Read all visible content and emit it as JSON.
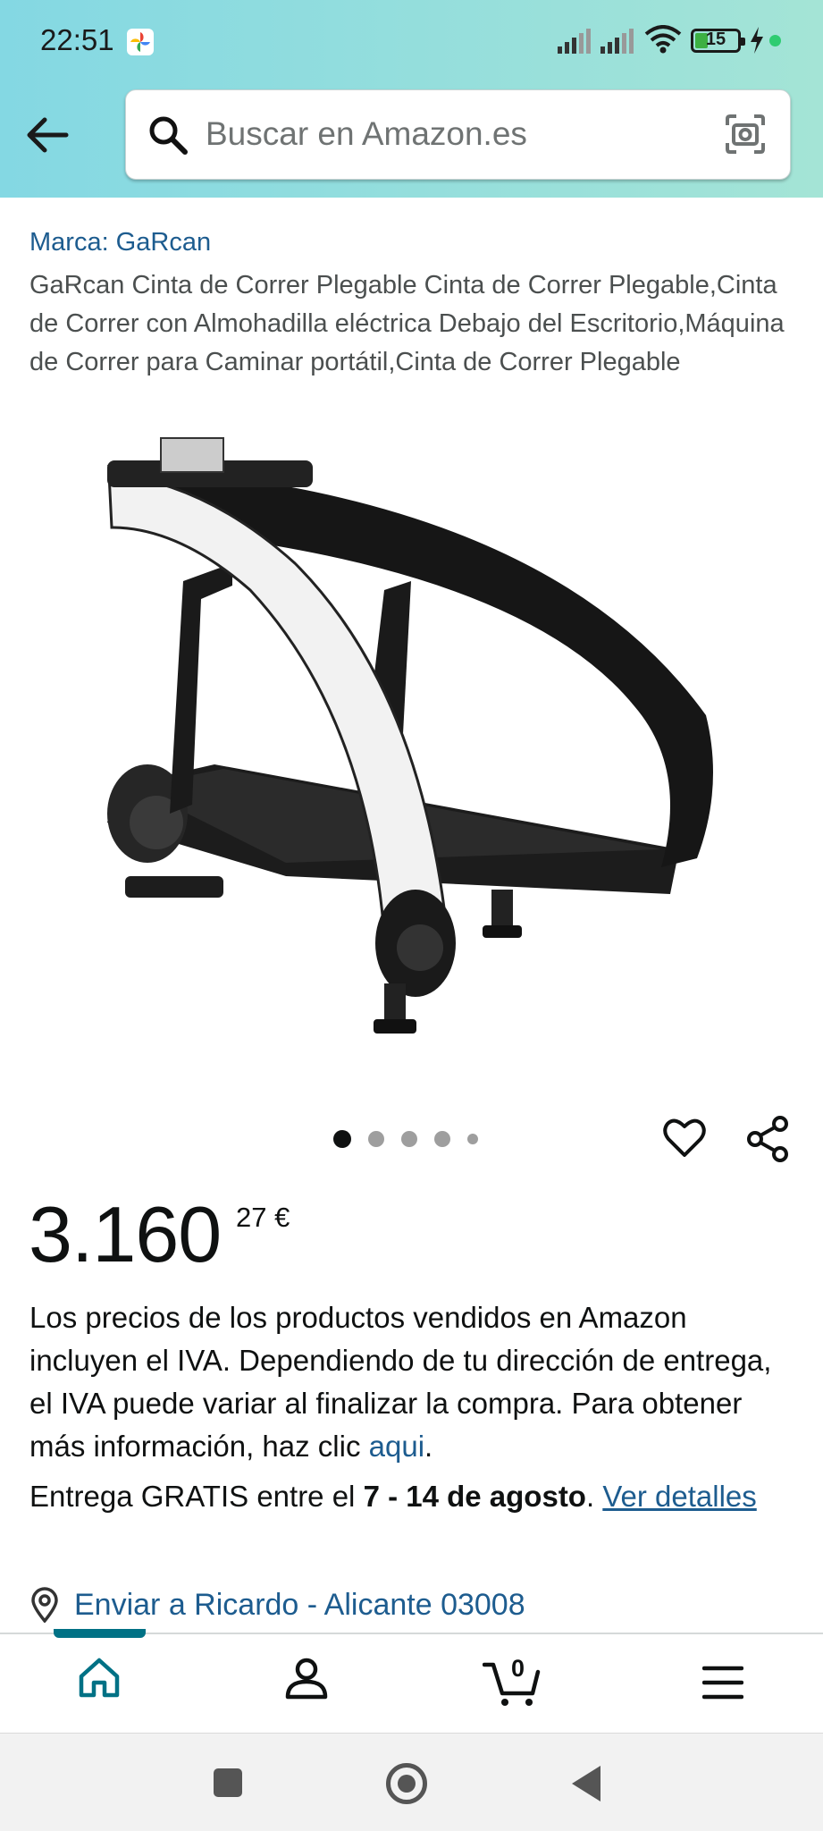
{
  "status_bar": {
    "time": "22:51",
    "battery": "15",
    "icons": [
      "photos-icon",
      "signal-icon",
      "signal-icon",
      "wifi-icon",
      "battery-icon",
      "charging-icon"
    ]
  },
  "header": {
    "back_icon": "arrow-left-icon",
    "search_placeholder": "Buscar en Amazon.es",
    "camera_icon": "camera-search-icon"
  },
  "product": {
    "brand": "Marca: GaRcan",
    "title": "GaRcan Cinta de Correr Plegable Cinta de Correr Plegable,Cinta de Correr con Almohadilla eléctrica Debajo del Escritorio,Máquina de Correr para Caminar portátil,Cinta de Correr Plegable",
    "image_alt": "treadmill",
    "carousel": {
      "count": 5,
      "active": 1
    },
    "price_whole": "3.160",
    "price_fraction": "27",
    "currency": "€"
  },
  "vat_notice": {
    "text": "Los precios de los productos vendidos en Amazon incluyen el IVA. Dependiendo de tu dirección de entrega, el IVA puede variar al finalizar la compra. Para obtener más información, haz clic ",
    "link": "aqui",
    "end": "."
  },
  "delivery": {
    "prefix": "Entrega GRATIS entre el ",
    "dates": "7 - 14 de agosto",
    "sep": ". ",
    "link": "Ver detalles"
  },
  "ship_to": "Enviar a Ricardo - Alicante 03008",
  "bottom_nav": {
    "items": [
      "home-icon",
      "account-icon",
      "cart-icon",
      "menu-icon"
    ],
    "cart_count": "0"
  },
  "colors": {
    "header_gradient_start": "#84d8e3",
    "header_gradient_end": "#a4e4d6",
    "link": "#1d5c8f",
    "nav_accent": "#007185"
  }
}
